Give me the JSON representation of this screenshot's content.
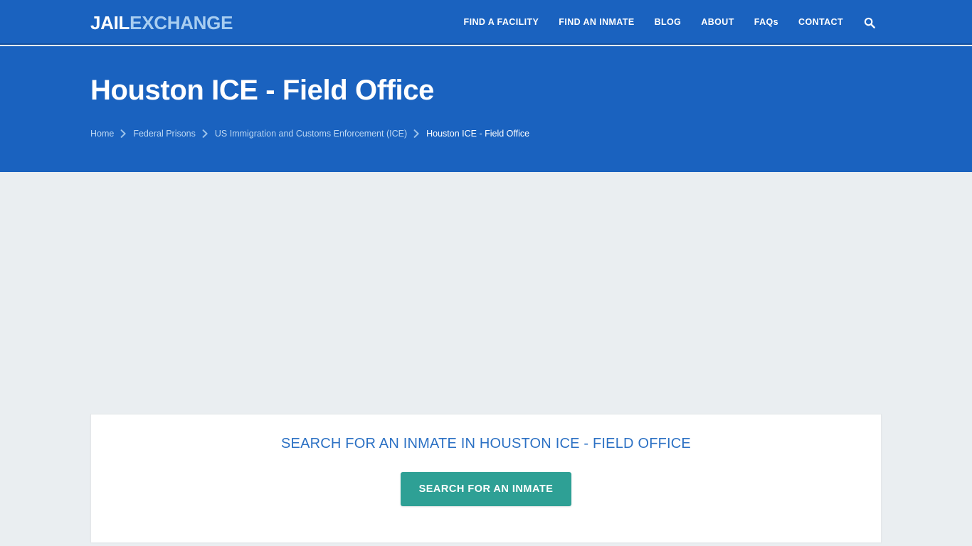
{
  "site": {
    "brand_part1": "JAIL",
    "brand_part2": "EXCHANGE",
    "accent_blue": "#1a62bf",
    "accent_teal": "#2ea095",
    "page_bg": "#eaeef1",
    "link_blue": "#2c71c4"
  },
  "nav": {
    "items": [
      {
        "label": "FIND A FACILITY"
      },
      {
        "label": "FIND AN INMATE"
      },
      {
        "label": "BLOG"
      },
      {
        "label": "ABOUT"
      },
      {
        "label": "FAQs"
      },
      {
        "label": "CONTACT"
      }
    ],
    "search_icon": "search-icon"
  },
  "hero": {
    "title": "Houston ICE - Field Office"
  },
  "breadcrumb": {
    "separator_icon": "chevron-right-icon",
    "items": [
      {
        "label": "Home",
        "current": false
      },
      {
        "label": "Federal Prisons",
        "current": false
      },
      {
        "label": "US Immigration and Customs Enforcement (ICE)",
        "current": false
      },
      {
        "label": "Houston ICE - Field Office",
        "current": true
      }
    ]
  },
  "search_card": {
    "title": "SEARCH FOR AN INMATE IN HOUSTON ICE - FIELD OFFICE",
    "button_label": "SEARCH FOR AN INMATE"
  }
}
